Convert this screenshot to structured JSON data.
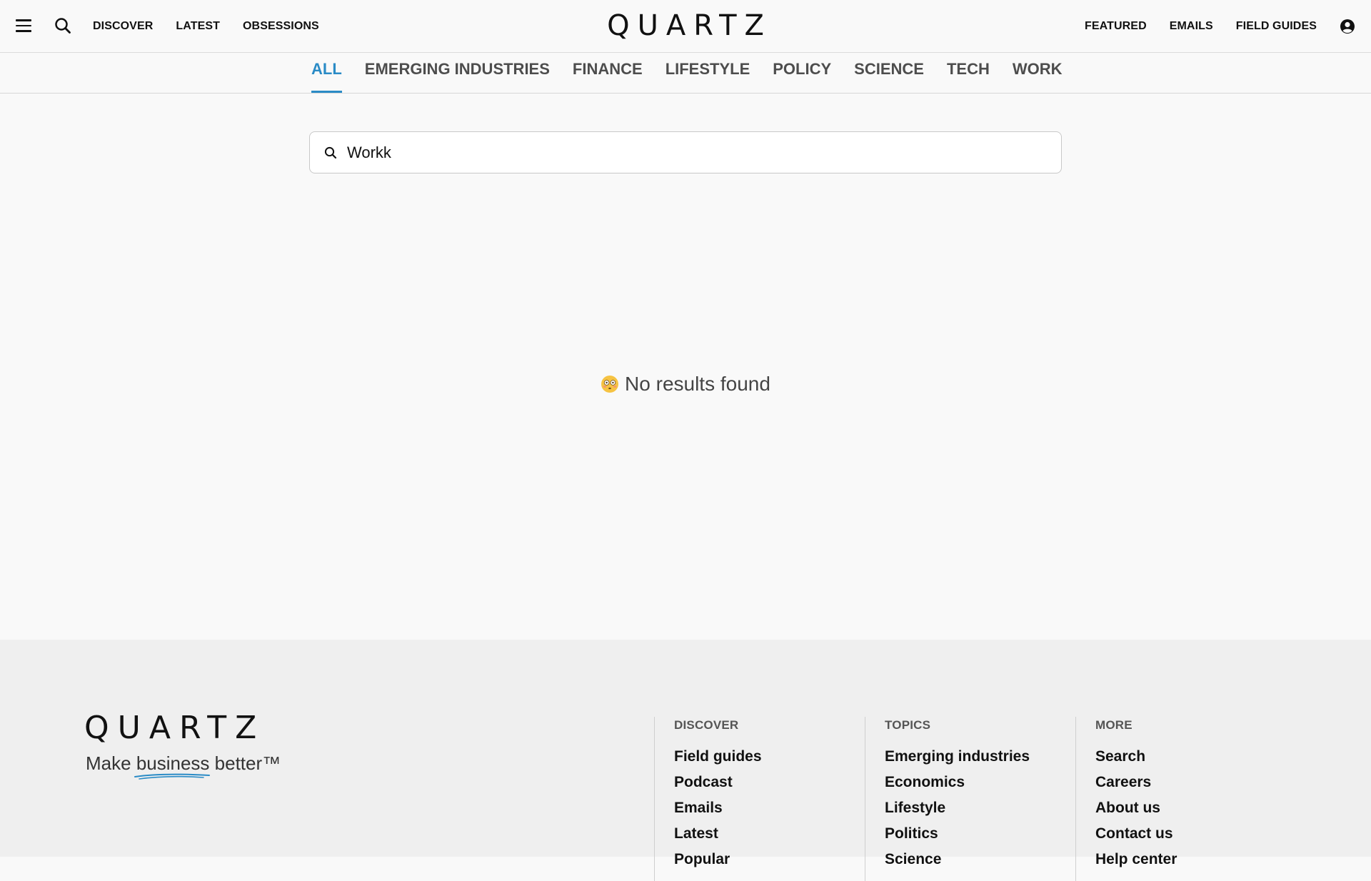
{
  "header": {
    "logo": "QUARTZ",
    "nav_left": [
      "DISCOVER",
      "LATEST",
      "OBSESSIONS"
    ],
    "nav_right": [
      "FEATURED",
      "EMAILS",
      "FIELD GUIDES"
    ]
  },
  "tabs": [
    {
      "label": "ALL",
      "active": true
    },
    {
      "label": "EMERGING INDUSTRIES"
    },
    {
      "label": "FINANCE"
    },
    {
      "label": "LIFESTYLE"
    },
    {
      "label": "POLICY"
    },
    {
      "label": "SCIENCE"
    },
    {
      "label": "TECH"
    },
    {
      "label": "WORK"
    }
  ],
  "search": {
    "value": "Workk"
  },
  "results": {
    "empty_message": "No results found"
  },
  "footer": {
    "logo": "QUARTZ",
    "tagline_before": "Make ",
    "tagline_underlined": "business",
    "tagline_after": " better™",
    "columns": [
      {
        "heading": "DISCOVER",
        "links": [
          "Field guides",
          "Podcast",
          "Emails",
          "Latest",
          "Popular"
        ]
      },
      {
        "heading": "TOPICS",
        "links": [
          "Emerging industries",
          "Economics",
          "Lifestyle",
          "Politics",
          "Science"
        ]
      },
      {
        "heading": "MORE",
        "links": [
          "Search",
          "Careers",
          "About us",
          "Contact us",
          "Help center"
        ]
      }
    ]
  },
  "colors": {
    "accent": "#2a8bc6",
    "background": "#f9f9f9",
    "footer_background": "#efefef"
  }
}
